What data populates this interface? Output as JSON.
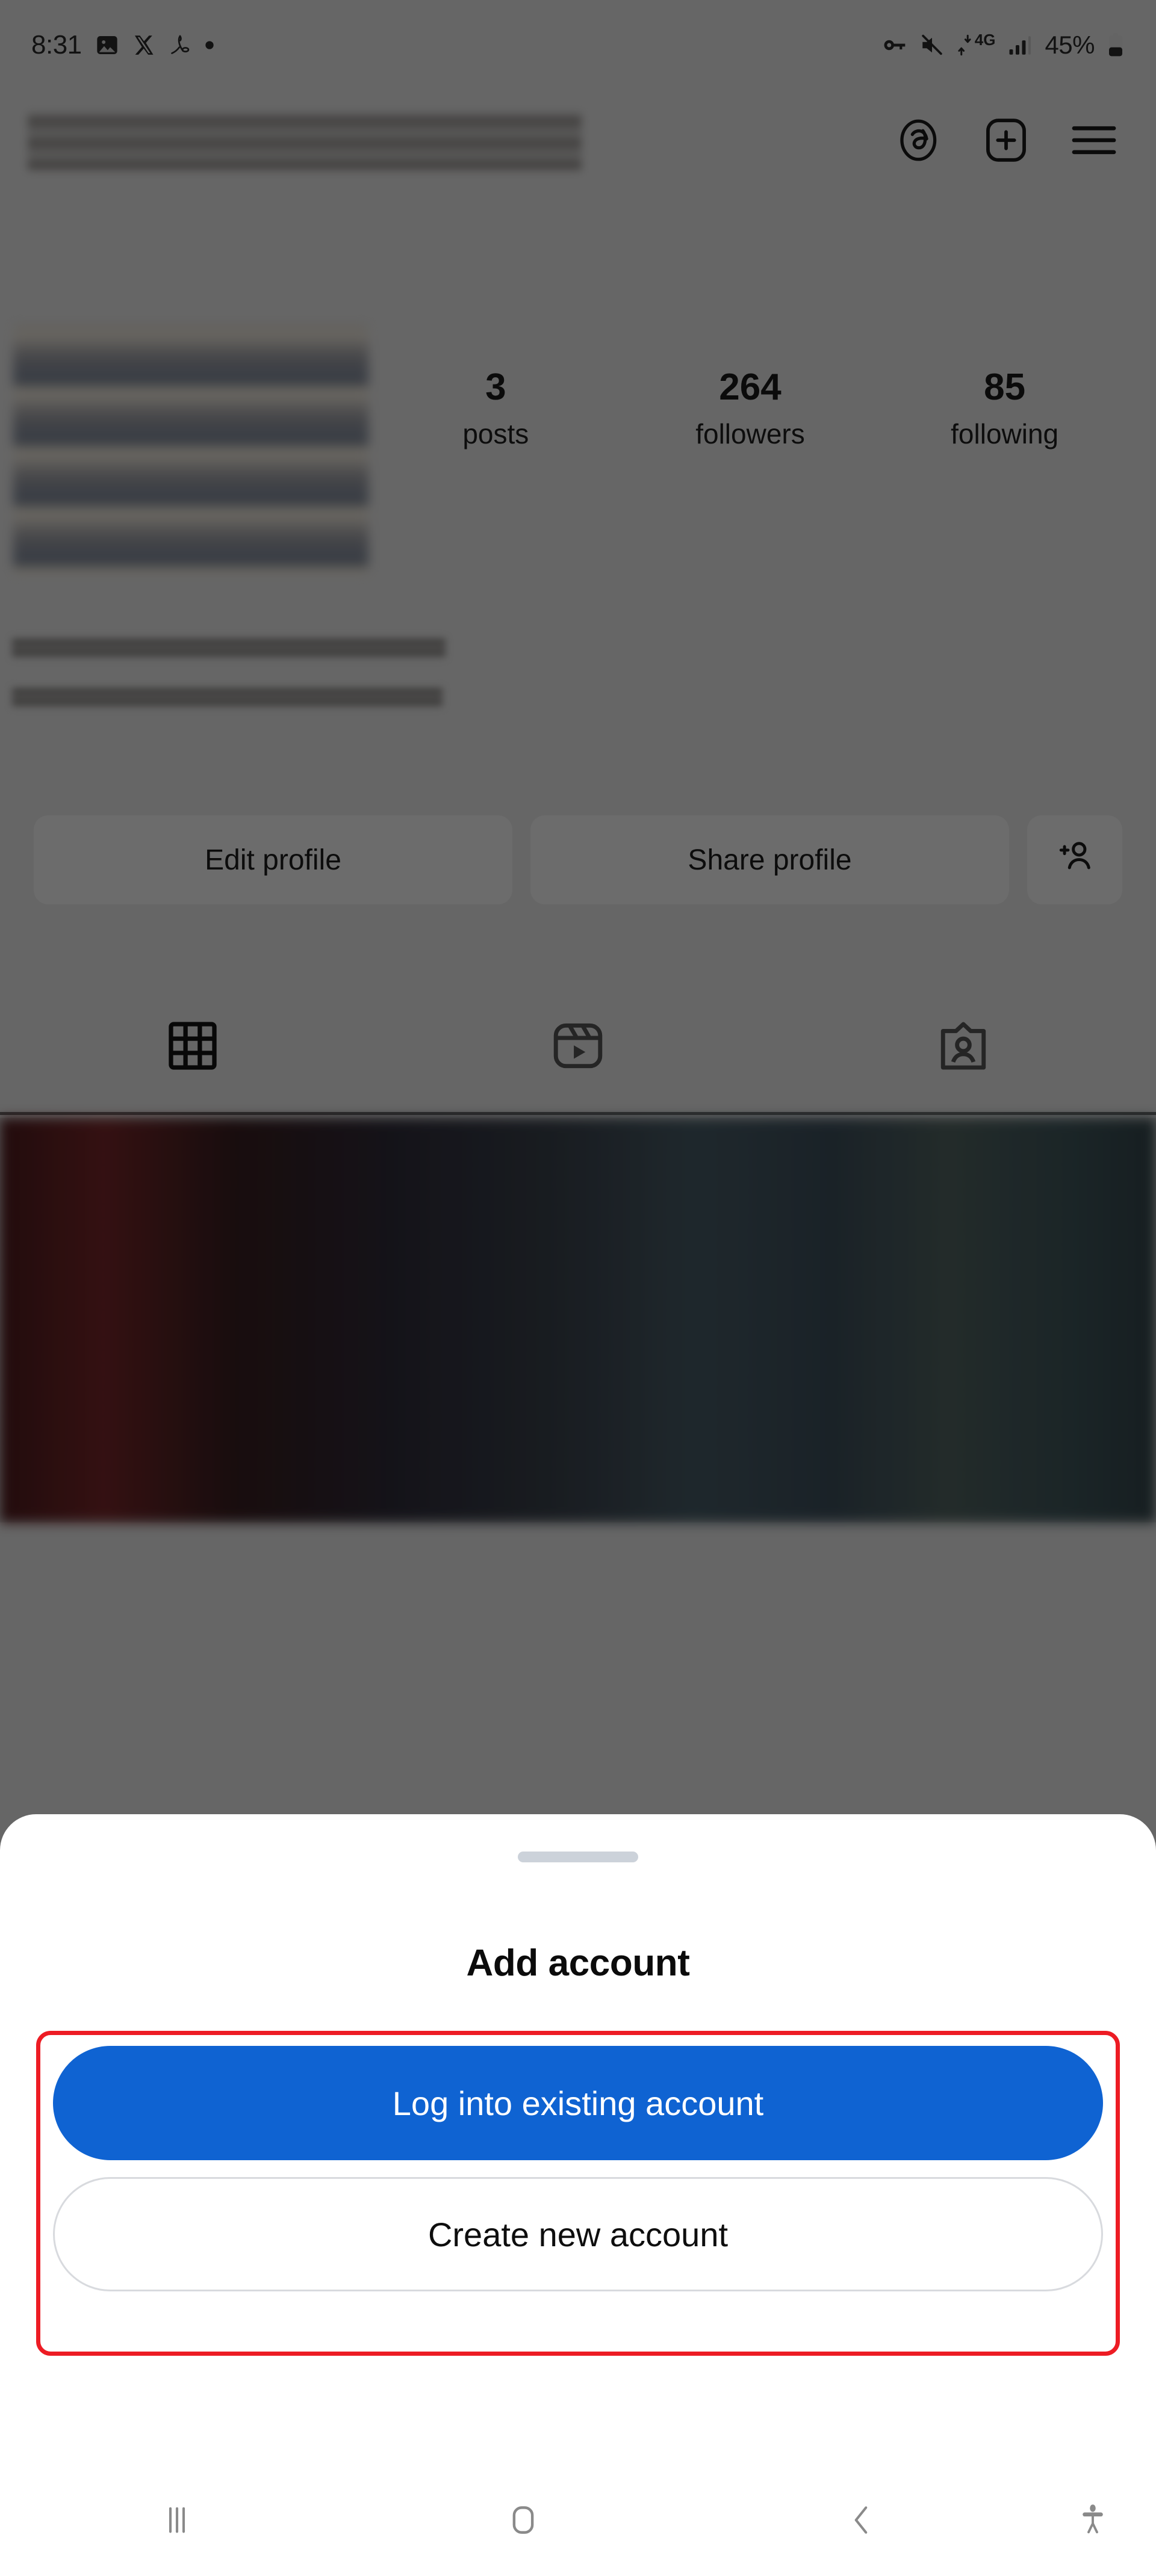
{
  "status_bar": {
    "time": "8:31",
    "left_icons": [
      "image-icon",
      "x-twitter-icon",
      "adobe-acrobat-icon",
      "dot-icon"
    ],
    "right_icons": [
      "vpn-key-icon",
      "mute-icon",
      "4g-data-icon",
      "signal-bars-icon",
      "battery-icon"
    ],
    "network_label": "4G",
    "battery_percent": "45%"
  },
  "app_header": {
    "username_redacted": "",
    "icons": [
      "threads-icon",
      "add-post-icon",
      "hamburger-menu-icon"
    ]
  },
  "profile": {
    "avatar_redacted": "",
    "stats": [
      {
        "value": "3",
        "label": "posts"
      },
      {
        "value": "264",
        "label": "followers"
      },
      {
        "value": "85",
        "label": "following"
      }
    ],
    "bio_redacted": "",
    "actions": {
      "edit_profile": "Edit profile",
      "share_profile": "Share profile",
      "add_person_icon": "add-person-icon"
    },
    "tabs": [
      {
        "name": "grid-tab",
        "icon": "grid-icon",
        "active": true
      },
      {
        "name": "reels-tab",
        "icon": "reels-icon",
        "active": false
      },
      {
        "name": "tagged-tab",
        "icon": "tagged-icon",
        "active": false
      }
    ]
  },
  "bottom_sheet": {
    "title": "Add account",
    "primary_button": "Log into existing account",
    "secondary_button": "Create new account",
    "highlight_color": "#ed1c24",
    "primary_color": "#0f63d2"
  },
  "nav_bar": {
    "recents": "recents-icon",
    "home": "home-icon",
    "back": "back-icon",
    "accessibility": "accessibility-icon"
  }
}
